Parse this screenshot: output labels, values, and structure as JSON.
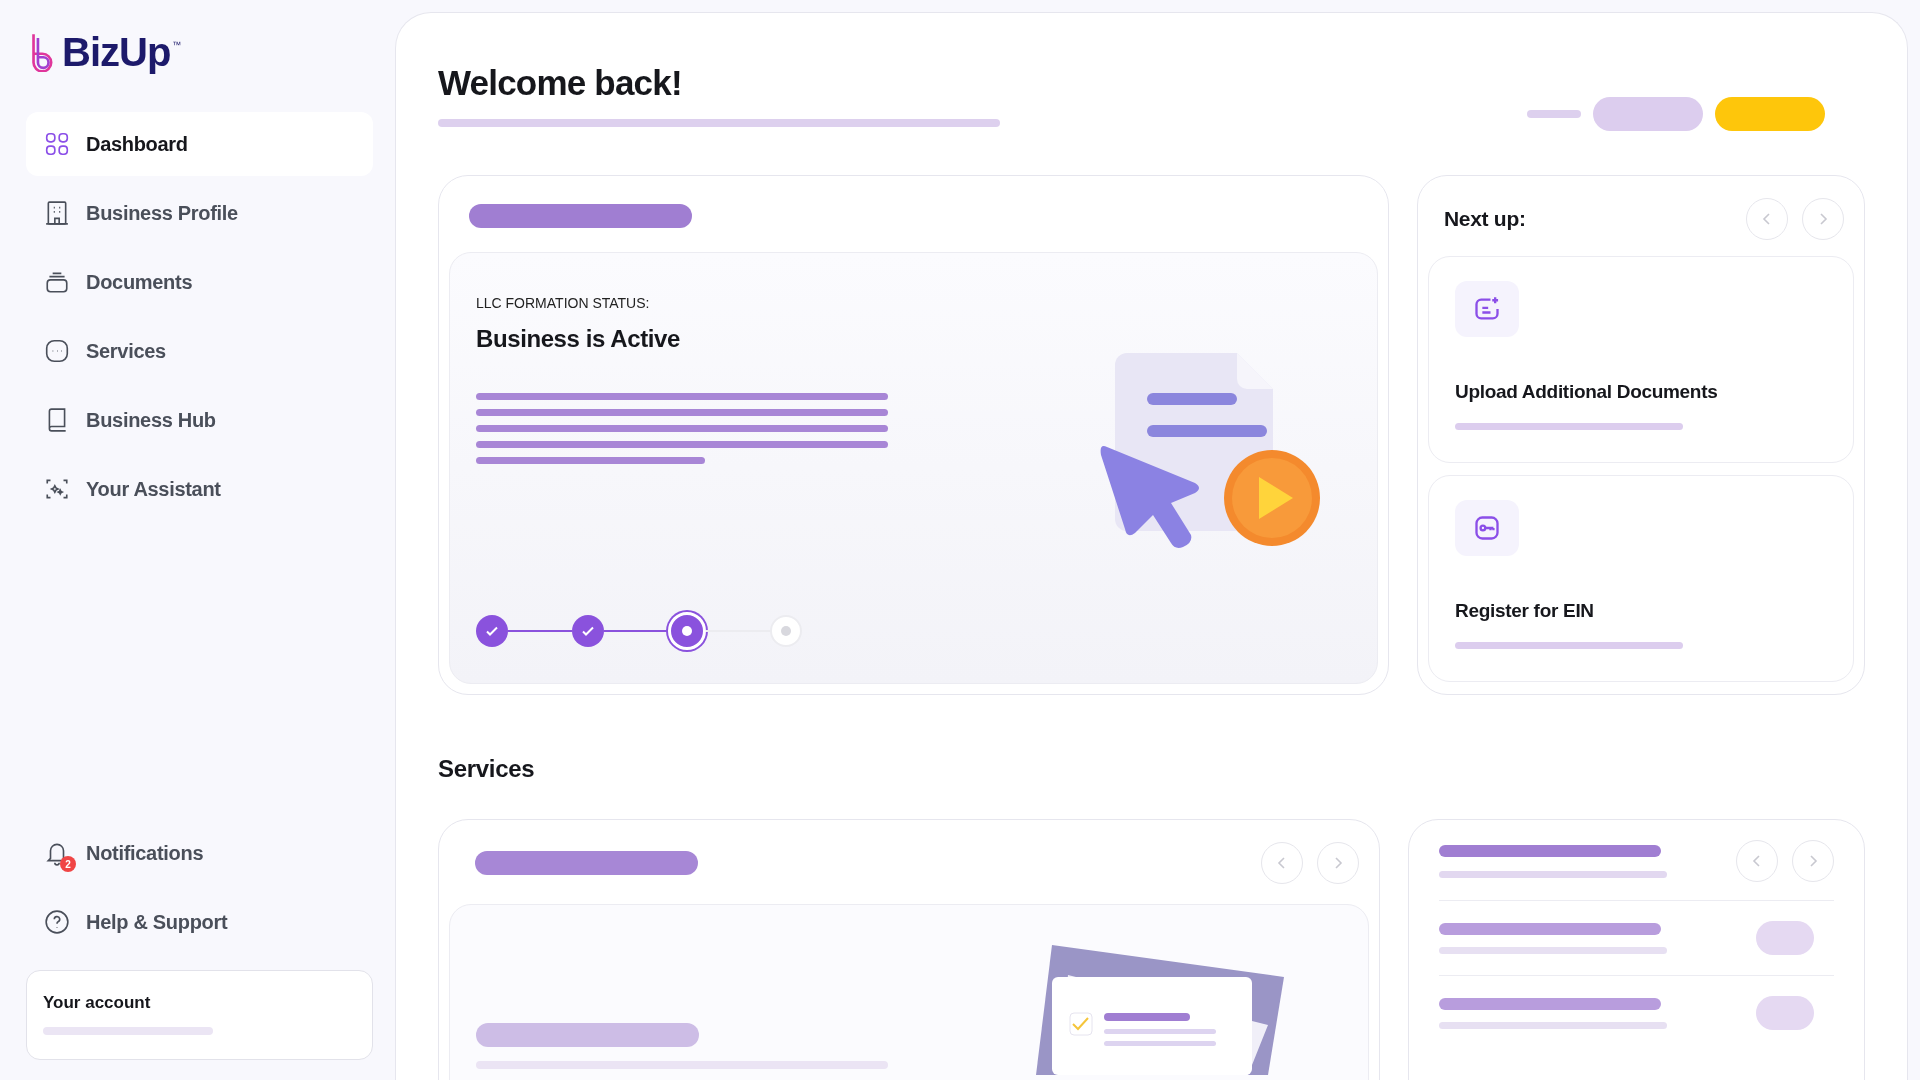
{
  "sidebar": {
    "logo": {
      "text": "BizUp",
      "mark": "™"
    },
    "nav": [
      {
        "label": "Dashboard",
        "selected": true
      },
      {
        "label": "Business Profile",
        "selected": false
      },
      {
        "label": "Documents",
        "selected": false
      },
      {
        "label": "Services",
        "selected": false
      },
      {
        "label": "Business Hub",
        "selected": false
      },
      {
        "label": "Your Assistant",
        "selected": false
      }
    ],
    "bottom_nav": [
      {
        "label": "Notifications",
        "badge": "2"
      },
      {
        "label": "Help & Support"
      }
    ],
    "account": {
      "title": "Your account"
    }
  },
  "main": {
    "title": "Welcome back!",
    "status_card": {
      "caption": "LLC FORMATION STATUS:",
      "status": "Business is Active",
      "steps": [
        {
          "done": true,
          "current": false
        },
        {
          "done": true,
          "current": false
        },
        {
          "done": false,
          "current": true
        },
        {
          "done": false,
          "current": false
        }
      ]
    },
    "next_up": {
      "title": "Next up:",
      "items": [
        {
          "title": "Upload Additional Documents"
        },
        {
          "title": "Register for EIN"
        }
      ]
    },
    "services": {
      "title": "Services"
    }
  }
}
